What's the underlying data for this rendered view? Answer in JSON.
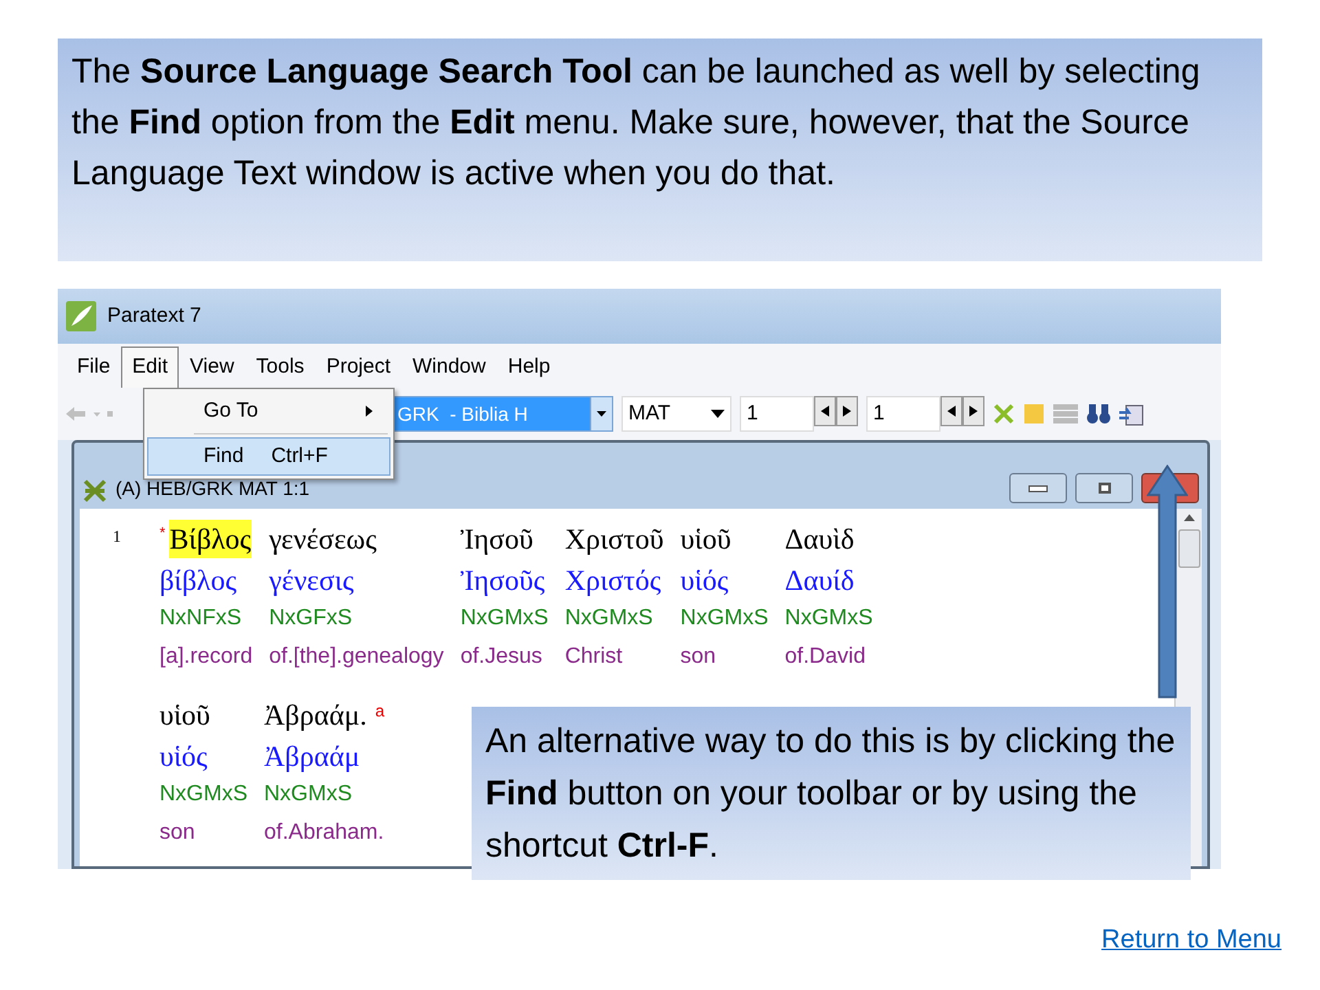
{
  "intro_callout": {
    "text": "The **Source Language Search Tool** can be launched as well by selecting the **Find** option from the **Edit** menu. Make sure, however, that the Source Language Text window is active when you do that."
  },
  "app_window": {
    "title": "Paratext 7",
    "menu_bar": [
      {
        "label": "File",
        "selected": false
      },
      {
        "label": "Edit",
        "selected": true
      },
      {
        "label": "View",
        "selected": false
      },
      {
        "label": "Tools",
        "selected": false
      },
      {
        "label": "Project",
        "selected": false
      },
      {
        "label": "Window",
        "selected": false
      },
      {
        "label": "Help",
        "selected": false
      }
    ],
    "edit_menu": [
      {
        "label": "Go To",
        "submenu": true,
        "selected": false
      },
      {
        "label": "Find",
        "shortcut": "Ctrl+F",
        "submenu": false,
        "selected": true
      }
    ],
    "toolbar": {
      "project": "GRK  - Biblia H",
      "book": "MAT",
      "chapter": "1",
      "verse": "1"
    },
    "text_window": {
      "title": "(A) HEB/GRK MAT 1:1",
      "verse_number": "1",
      "lines": [
        [
          {
            "surface": "Βίβλος",
            "marker": "*",
            "highlighted": true,
            "lemma": "βίβλος",
            "morph": "NxNFxS",
            "gloss": "[a].record"
          },
          {
            "surface": "γενέσεως",
            "highlighted": false,
            "lemma": "γένεσις",
            "morph": "NxGFxS",
            "gloss": "of.[the].genealogy"
          },
          {
            "surface": "Ἰησοῦ",
            "highlighted": false,
            "lemma": "Ἰησοῦς",
            "morph": "NxGMxS",
            "gloss": "of.Jesus"
          },
          {
            "surface": "Χριστοῦ",
            "highlighted": false,
            "lemma": "Χριστός",
            "morph": "NxGMxS",
            "gloss": "Christ"
          },
          {
            "surface": "υἱοῦ",
            "highlighted": false,
            "lemma": "υἱός",
            "morph": "NxGMxS",
            "gloss": "son"
          },
          {
            "surface": "Δαυὶδ",
            "highlighted": false,
            "lemma": "Δαυίδ",
            "morph": "NxGMxS",
            "gloss": "of.David"
          }
        ],
        [
          {
            "surface": "υἱοῦ",
            "highlighted": false,
            "lemma": "υἱός",
            "morph": "NxGMxS",
            "gloss": "son"
          },
          {
            "surface": "Ἀβραάμ.",
            "footnote": "a",
            "highlighted": false,
            "lemma": "Ἀβραάμ",
            "morph": "NxGMxS",
            "gloss": "of.Abraham."
          }
        ]
      ]
    }
  },
  "tip_callout": {
    "text": "An alternative way to do this is by clicking the **Find** button on your toolbar or by using the shortcut **Ctrl-F**."
  },
  "return_link": "Return to Menu"
}
